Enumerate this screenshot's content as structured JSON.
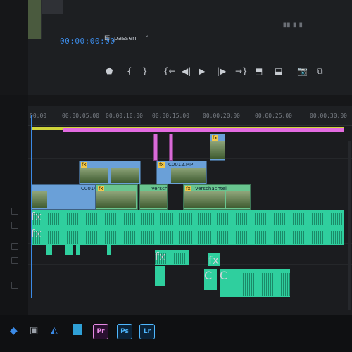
{
  "program": {
    "timecode": "00:00:00:00",
    "fit_label": "Einpassen",
    "fit_chevron": "chevron-down-icon"
  },
  "transport": {
    "buttons": [
      {
        "name": "add-marker-button",
        "glyph": "⬟"
      },
      {
        "name": "mark-in-button",
        "glyph": "{"
      },
      {
        "name": "mark-out-button",
        "glyph": "}"
      },
      {
        "name": "go-to-in-button",
        "glyph": "{←"
      },
      {
        "name": "step-back-button",
        "glyph": "◀|"
      },
      {
        "name": "play-button",
        "glyph": "▶"
      },
      {
        "name": "step-forward-button",
        "glyph": "|▶"
      },
      {
        "name": "go-to-out-button",
        "glyph": "→}"
      },
      {
        "name": "lift-button",
        "glyph": "⬒"
      },
      {
        "name": "extract-button",
        "glyph": "⬓"
      },
      {
        "name": "export-frame-button",
        "glyph": "📷"
      },
      {
        "name": "comparison-view-button",
        "glyph": "⧉"
      }
    ]
  },
  "timeline": {
    "ruler_labels": [
      "00:00",
      "00:00:05:00",
      "00:00:10:00",
      "00:00:15:00",
      "00:00:20:00",
      "00:00:25:00",
      "00:00:30:00"
    ],
    "clips": {
      "c0012": "C0012.MP",
      "c0014": "C0014",
      "versch1": "Verscha",
      "versch2": "Verschachtel",
      "fx": "fx",
      "c1": "C"
    }
  },
  "taskbar": {
    "apps": [
      {
        "name": "premiere-pro-app",
        "label": "Pr",
        "color": "#e78ae4",
        "bg": "#2a1030"
      },
      {
        "name": "photoshop-app",
        "label": "Ps",
        "color": "#4fb8ff",
        "bg": "#0b2338"
      },
      {
        "name": "lightroom-app",
        "label": "Lr",
        "color": "#4fb8ff",
        "bg": "#0b2338"
      }
    ]
  },
  "colors": {
    "accent": "#3b8ae6",
    "video_clip": "#6aa0d8",
    "nested_clip": "#69c58f",
    "audio_clip": "#2fcf9e",
    "adjustment_clip": "#d96bd8",
    "work_area": "#cfd43a"
  }
}
